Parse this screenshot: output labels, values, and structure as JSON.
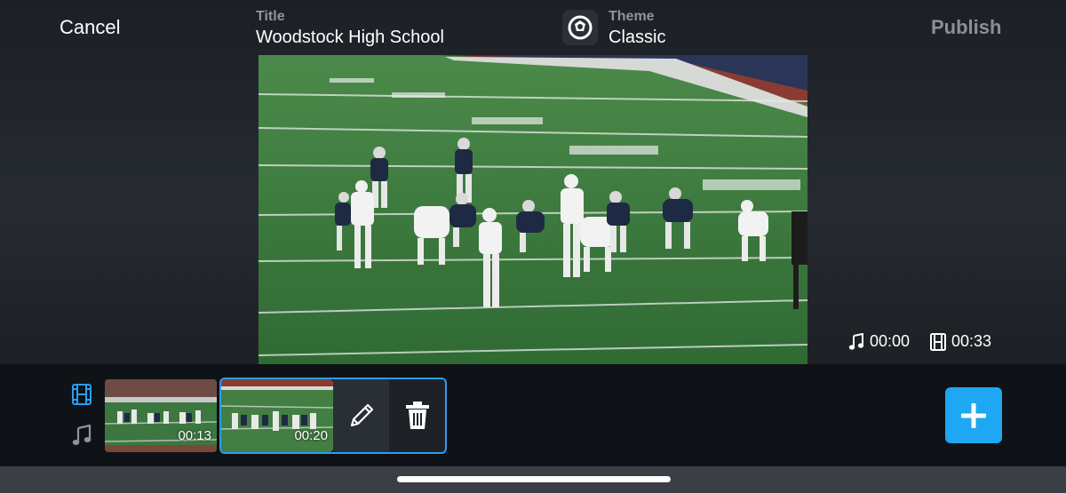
{
  "header": {
    "cancel_label": "Cancel",
    "title_caption": "Title",
    "title_value": "Woodstock High School",
    "theme_caption": "Theme",
    "theme_value": "Classic",
    "publish_label": "Publish"
  },
  "preview": {
    "music_time": "00:00",
    "video_time": "00:33"
  },
  "timeline": {
    "video_track_icon": "film-icon",
    "music_track_icon": "music-note-icon",
    "clips": [
      {
        "duration": "00:13"
      },
      {
        "duration": "00:20"
      }
    ],
    "edit_icon": "pencil-icon",
    "delete_icon": "trash-icon",
    "add_icon": "plus-icon"
  },
  "colors": {
    "accent": "#1ea7f2",
    "selection": "#2a9df4",
    "publish_disabled": "#8b9097",
    "field_green": "#3f7a3e"
  }
}
